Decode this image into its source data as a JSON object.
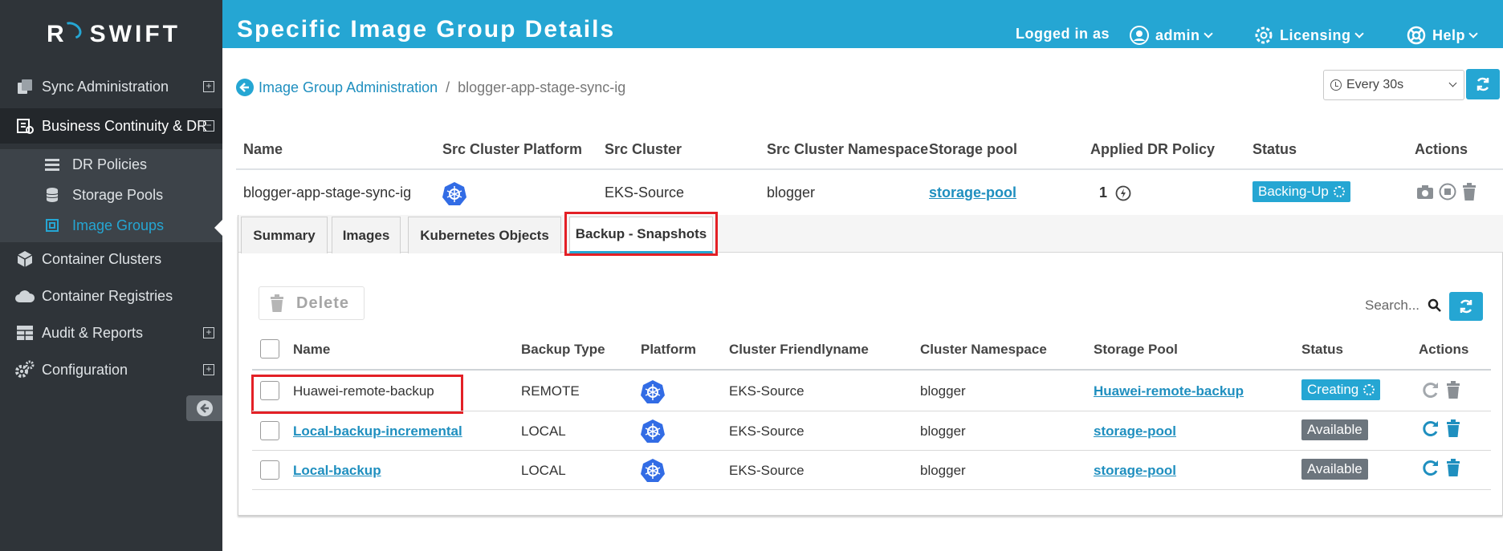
{
  "sidebar": {
    "logo_left": "R",
    "logo_right": "SWIFT",
    "items": [
      {
        "label": "Sync Administration"
      },
      {
        "label": "Business Continuity & DR"
      },
      {
        "label": "Container Clusters"
      },
      {
        "label": "Container Registries"
      },
      {
        "label": "Audit & Reports"
      },
      {
        "label": "Configuration"
      }
    ],
    "sub_items": [
      {
        "label": "DR Policies"
      },
      {
        "label": "Storage Pools"
      },
      {
        "label": "Image Groups"
      }
    ],
    "plus": "⊞",
    "minus": "⊟"
  },
  "header": {
    "title": "Specific Image Group Details",
    "logged_in_as": "Logged in as",
    "user": "admin",
    "licensing": "Licensing",
    "help": "Help"
  },
  "breadcrumb": {
    "parent": "Image Group Administration",
    "separator": "/",
    "current": "blogger-app-stage-sync-ig"
  },
  "refresh": {
    "selected": "Every 30s"
  },
  "group_table": {
    "headers": [
      "Name",
      "Src Cluster Platform",
      "Src Cluster",
      "Src Cluster Namespace",
      "Storage pool",
      "Applied DR Policy",
      "Status",
      "Actions"
    ],
    "row": {
      "name": "blogger-app-stage-sync-ig",
      "src_cluster": "EKS-Source",
      "namespace": "blogger",
      "storage_pool": "storage-pool",
      "dr_policy": "1",
      "status": "Backing-Up"
    }
  },
  "tabs": [
    "Summary",
    "Images",
    "Kubernetes Objects",
    "Backup - Snapshots"
  ],
  "snapshots": {
    "delete_label": "Delete",
    "search_placeholder": "Search...",
    "headers": [
      "Name",
      "Backup Type",
      "Platform",
      "Cluster Friendlyname",
      "Cluster Namespace",
      "Storage Pool",
      "Status",
      "Actions"
    ],
    "rows": [
      {
        "name": "Huawei-remote-backup",
        "backup_type": "REMOTE",
        "cluster": "EKS-Source",
        "namespace": "blogger",
        "storage_pool": "Huawei-remote-backup",
        "status": "Creating"
      },
      {
        "name": "Local-backup-incremental",
        "backup_type": "LOCAL",
        "cluster": "EKS-Source",
        "namespace": "blogger",
        "storage_pool": "storage-pool",
        "status": "Available"
      },
      {
        "name": "Local-backup",
        "backup_type": "LOCAL",
        "cluster": "EKS-Source",
        "namespace": "blogger",
        "storage_pool": "storage-pool",
        "status": "Available"
      }
    ]
  },
  "colors": {
    "accent": "#25a6d3",
    "sidebar": "#2f3439",
    "highlight_box": "#e32026",
    "k8s_blue": "#326ce5"
  }
}
